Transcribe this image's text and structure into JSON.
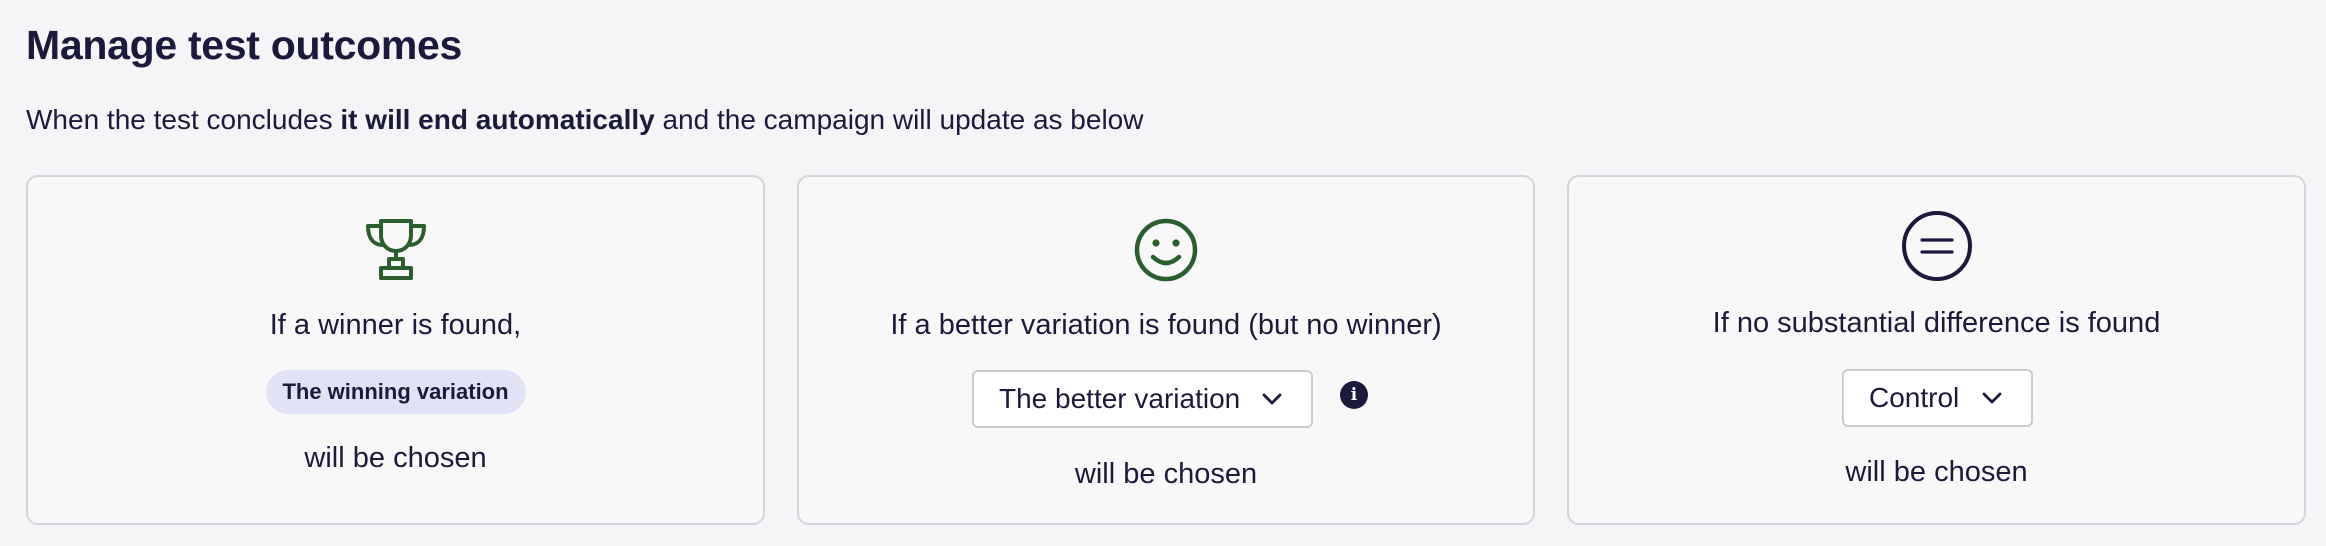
{
  "header": {
    "title": "Manage test outcomes",
    "description_prefix": "When the test concludes ",
    "description_bold": "it will end automatically",
    "description_suffix": " and the campaign will update as below"
  },
  "cards": [
    {
      "icon": "trophy-icon",
      "condition": "If a winner is found,",
      "selection": "The winning variation",
      "result": "will be chosen",
      "icon_color": "#2a5e2d"
    },
    {
      "icon": "smiley-icon",
      "condition": "If a better variation is found (but no winner)",
      "selection": "The better variation",
      "info_glyph": "i",
      "result": "will be chosen",
      "icon_color": "#2a5e2d"
    },
    {
      "icon": "equals-icon",
      "condition": "If no substantial difference is found",
      "selection": "Control",
      "result": "will be chosen",
      "icon_color": "#1b1a3d"
    }
  ],
  "colors": {
    "text": "#1b1a3d",
    "pill_bg": "#e2e2f6",
    "card_border": "#d3d4dc",
    "page_bg": "#f5f5f7"
  }
}
